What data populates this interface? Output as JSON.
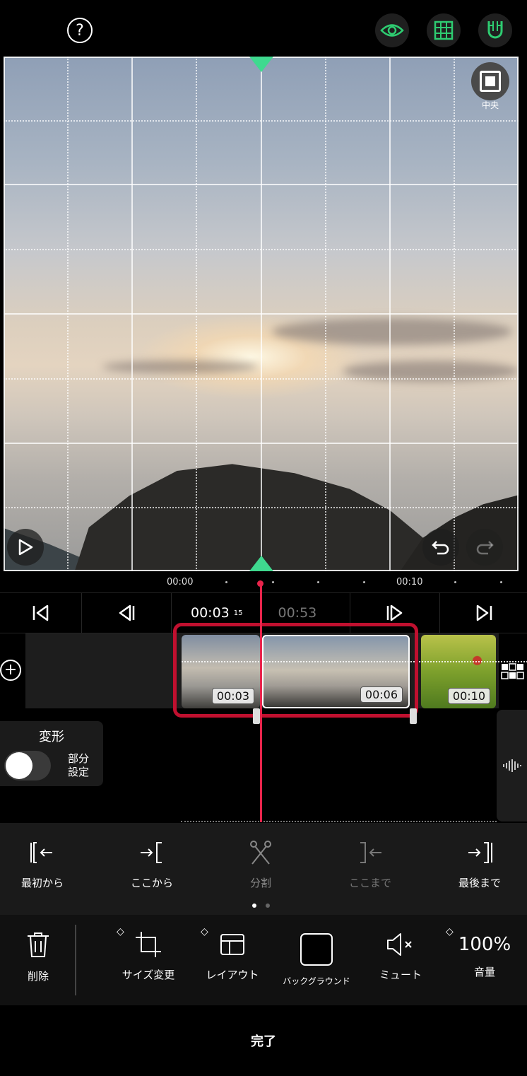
{
  "topbar": {
    "help_icon": "question-circle-icon",
    "eye_icon": "eye-icon",
    "grid_icon": "grid-icon",
    "magnet_icon": "magnet-icon",
    "accent": "#2ecc71"
  },
  "preview": {
    "center_label": "中央"
  },
  "ruler": {
    "t0": "00:00",
    "t1": "00:10"
  },
  "nav": {
    "current_time": "00:03",
    "current_frame": "15",
    "total_time": "00:53"
  },
  "clips": [
    {
      "duration": "00:03"
    },
    {
      "duration": "00:06"
    },
    {
      "duration": "00:10"
    }
  ],
  "transform": {
    "title": "変形",
    "toggle_label_line1": "部分",
    "toggle_label_line2": "設定",
    "toggle_on": false
  },
  "edit_actions": [
    {
      "label": "最初から",
      "enabled": true
    },
    {
      "label": "ここから",
      "enabled": true
    },
    {
      "label": "分割",
      "enabled": false
    },
    {
      "label": "ここまで",
      "enabled": false
    },
    {
      "label": "最後まで",
      "enabled": true
    }
  ],
  "bottom_actions": {
    "delete": "削除",
    "resize": "サイズ変更",
    "layout": "レイアウト",
    "background": "バックグラウンド",
    "mute": "ミュート",
    "volume_value": "100%",
    "volume": "音量"
  },
  "done_label": "完了",
  "colors": {
    "selection": "#c0102f",
    "playhead": "#e8244b",
    "marker": "#3fd98f"
  }
}
